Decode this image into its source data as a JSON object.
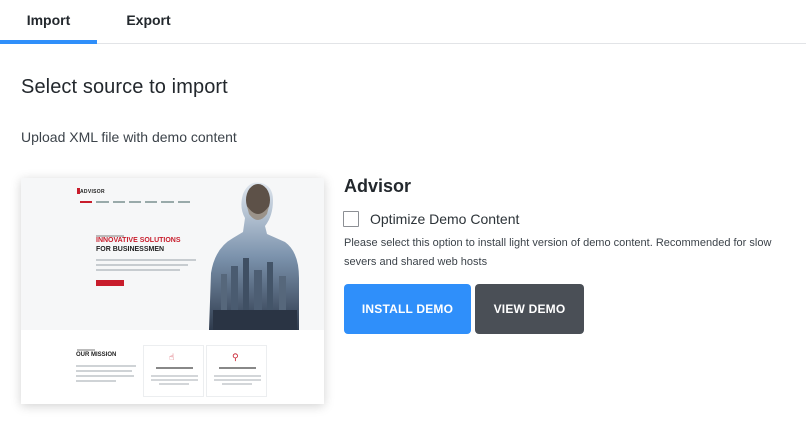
{
  "tabs": [
    {
      "label": "Import",
      "active": true
    },
    {
      "label": "Export",
      "active": false
    }
  ],
  "page": {
    "title": "Select source to import",
    "subtitle": "Upload XML file with demo content"
  },
  "preview": {
    "logo": "ADVISOR",
    "heading_red": "INNOVATIVE SOLUTIONS",
    "heading_dark": "FOR BUSINESSMEN",
    "mission": "OUR MISSION"
  },
  "demo": {
    "name": "Advisor",
    "optimize_label": "Optimize Demo Content",
    "optimize_checked": false,
    "optimize_description": "Please select this option to install light version of demo content. Recommended for slow severs and shared web hosts",
    "install_button": "INSTALL DEMO",
    "view_button": "VIEW DEMO"
  },
  "colors": {
    "accent": "#2f8ffa",
    "dark_button": "#4a4f56",
    "preview_red": "#c81d2c"
  }
}
